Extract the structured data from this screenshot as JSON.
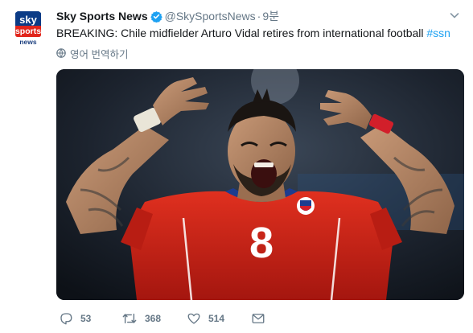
{
  "tweet": {
    "author": {
      "name": "Sky Sports News",
      "handle": "@SkySportsNews",
      "verified": true,
      "avatar_lines": [
        "sky",
        "sports",
        "news"
      ],
      "avatar_colors": {
        "top": "#e1251b",
        "bottom": "#0b3b86"
      }
    },
    "separator": "·",
    "time": "9분",
    "text": "BREAKING: Chile midfielder Arturo Vidal retires from international football",
    "hashtag": "#ssn",
    "translate_label": "영어 번역하기",
    "media": {
      "jersey_number": "8",
      "jersey_color": "#d7261b"
    },
    "actions": {
      "replies": "53",
      "retweets": "368",
      "likes": "514"
    },
    "colors": {
      "link": "#1da1f2",
      "verified": "#1da1f2",
      "muted": "#657786"
    },
    "icons": [
      "verified-icon",
      "chevron-down-icon",
      "globe-icon",
      "reply-icon",
      "retweet-icon",
      "like-icon",
      "message-icon"
    ]
  }
}
